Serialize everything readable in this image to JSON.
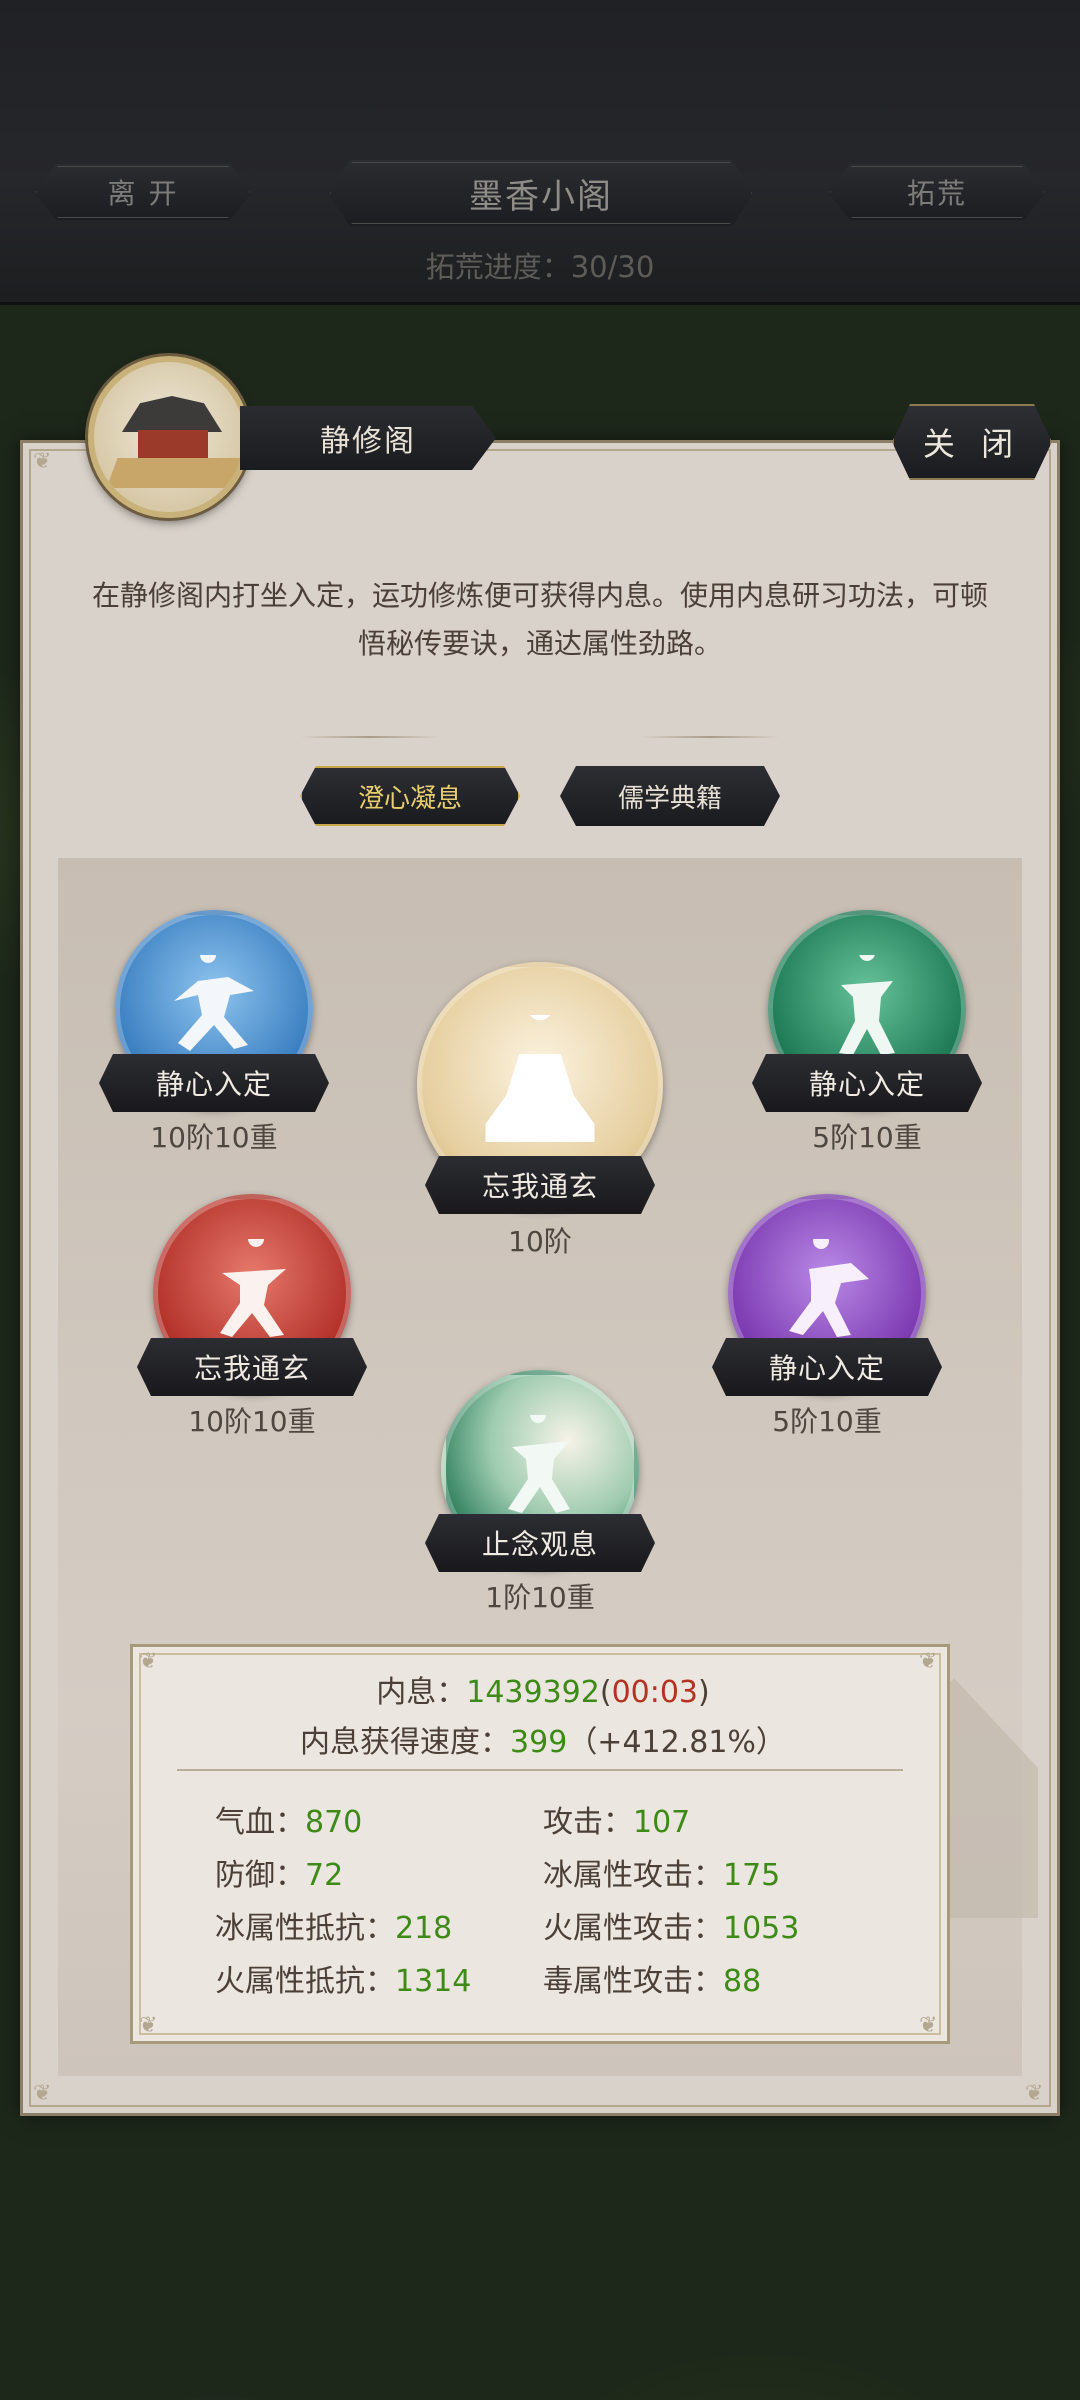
{
  "header": {
    "leave_label": "离 开",
    "title": "墨香小阁",
    "explore_label": "拓荒",
    "progress": "拓荒进度：30/30"
  },
  "panel": {
    "name": "静修阁",
    "close_label": "关 闭",
    "description": "在静修阁内打坐入定，运功修炼便可获得内息。使用内息研习功法，可顿悟秘传要诀，通达属性劲路。",
    "tabs": [
      {
        "label": "澄心凝息",
        "active": true
      },
      {
        "label": "儒学典籍",
        "active": false
      }
    ]
  },
  "skills": [
    {
      "name": "静心入定",
      "level": "10阶10重",
      "color": "#3b7fc1"
    },
    {
      "name": "静心入定",
      "level": "5阶10重",
      "color": "#1e7a55"
    },
    {
      "name": "忘我通玄",
      "level": "10阶",
      "color": "#d9bf86"
    },
    {
      "name": "忘我通玄",
      "level": "10阶10重",
      "color": "#b3322a"
    },
    {
      "name": "静心入定",
      "level": "5阶10重",
      "color": "#7c3ab1"
    },
    {
      "name": "止念观息",
      "level": "1阶10重",
      "color": "#2a7c5a"
    }
  ],
  "stats": {
    "inner_label": "内息：",
    "inner_value": "1439392",
    "inner_timer_open": "(",
    "inner_timer": "00:03",
    "inner_timer_close": ")",
    "speed_label": "内息获得速度：",
    "speed_value": "399",
    "speed_bonus": "（+412.81%）",
    "rows": [
      {
        "label": "气血：",
        "value": "870"
      },
      {
        "label": "攻击：",
        "value": "107"
      },
      {
        "label": "防御：",
        "value": "72"
      },
      {
        "label": "冰属性攻击：",
        "value": "175"
      },
      {
        "label": "冰属性抵抗：",
        "value": "218"
      },
      {
        "label": "火属性攻击：",
        "value": "1053"
      },
      {
        "label": "火属性抵抗：",
        "value": "1314"
      },
      {
        "label": "毒属性攻击：",
        "value": "88"
      }
    ]
  }
}
